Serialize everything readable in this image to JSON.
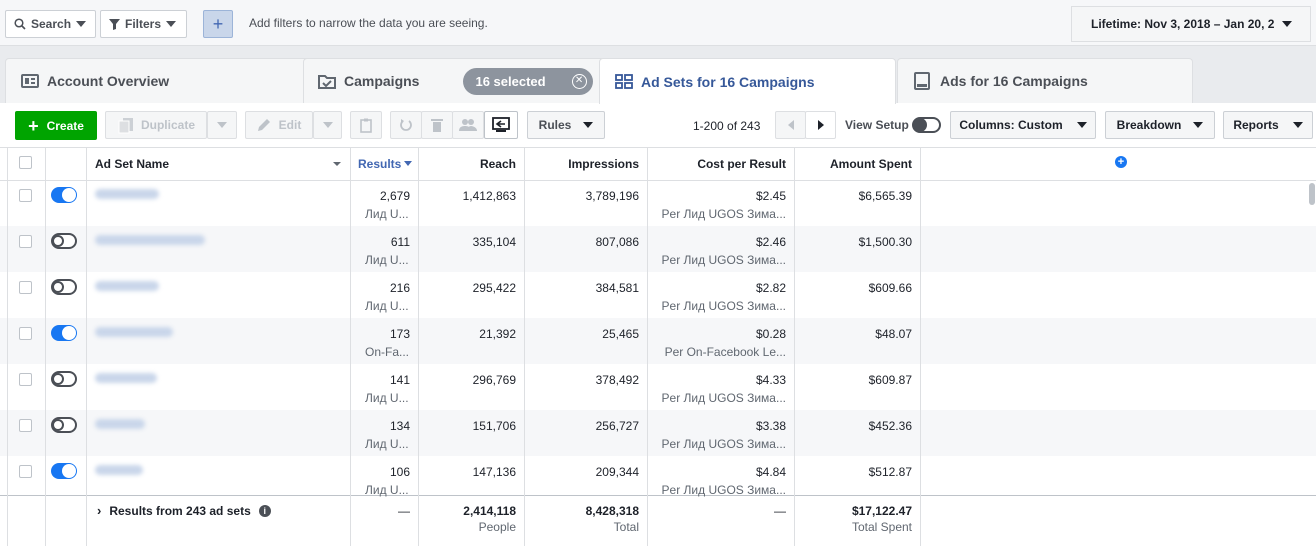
{
  "filterbar": {
    "search_label": "Search",
    "filters_label": "Filters",
    "hint": "Add filters to narrow the data you are seeing.",
    "date_label": "Lifetime: Nov 3, 2018 – Jan 20, 2"
  },
  "tabs": {
    "account_overview": "Account Overview",
    "campaigns": "Campaigns",
    "selected_badge": "16 selected",
    "adsets": "Ad Sets for 16 Campaigns",
    "ads": "Ads for 16 Campaigns"
  },
  "toolbar": {
    "create": "Create",
    "duplicate": "Duplicate",
    "edit": "Edit",
    "rules": "Rules",
    "pagination": "1-200 of 243",
    "view_setup": "View Setup",
    "columns": "Columns: Custom",
    "breakdown": "Breakdown",
    "reports": "Reports"
  },
  "table": {
    "headers": {
      "name": "Ad Set Name",
      "results": "Results",
      "reach": "Reach",
      "impressions": "Impressions",
      "cost": "Cost per Result",
      "spent": "Amount Spent"
    },
    "rows": [
      {
        "on": true,
        "results": "2,679",
        "results_sub": "Лид U...",
        "reach": "1,412,863",
        "impressions": "3,789,196",
        "cost": "$2.45",
        "cost_sub": "Per Лид UGOS Зима...",
        "spent": "$6,565.39"
      },
      {
        "on": false,
        "results": "611",
        "results_sub": "Лид U...",
        "reach": "335,104",
        "impressions": "807,086",
        "cost": "$2.46",
        "cost_sub": "Per Лид UGOS Зима...",
        "spent": "$1,500.30"
      },
      {
        "on": false,
        "results": "216",
        "results_sub": "Лид U...",
        "reach": "295,422",
        "impressions": "384,581",
        "cost": "$2.82",
        "cost_sub": "Per Лид UGOS Зима...",
        "spent": "$609.66"
      },
      {
        "on": true,
        "results": "173",
        "results_sub": "On-Fa...",
        "reach": "21,392",
        "impressions": "25,465",
        "cost": "$0.28",
        "cost_sub": "Per On-Facebook Le...",
        "spent": "$48.07"
      },
      {
        "on": false,
        "results": "141",
        "results_sub": "Лид U...",
        "reach": "296,769",
        "impressions": "378,492",
        "cost": "$4.33",
        "cost_sub": "Per Лид UGOS Зима...",
        "spent": "$609.87"
      },
      {
        "on": false,
        "results": "134",
        "results_sub": "Лид U...",
        "reach": "151,706",
        "impressions": "256,727",
        "cost": "$3.38",
        "cost_sub": "Per Лид UGOS Зима...",
        "spent": "$452.36"
      },
      {
        "on": true,
        "results": "106",
        "results_sub": "Лид U...",
        "reach": "147,136",
        "impressions": "209,344",
        "cost": "$4.84",
        "cost_sub": "Per Лид UGOS Зима...",
        "spent": "$512.87"
      }
    ],
    "summary": {
      "label": "Results from 243 ad sets",
      "results": "—",
      "reach": "2,414,118",
      "reach_sub": "People",
      "impressions": "8,428,318",
      "impressions_sub": "Total",
      "cost": "—",
      "spent": "$17,122.47",
      "spent_sub": "Total Spent"
    }
  },
  "colors": {
    "accent": "#1877f2",
    "create_green": "#00a400",
    "link_blue": "#365899"
  }
}
